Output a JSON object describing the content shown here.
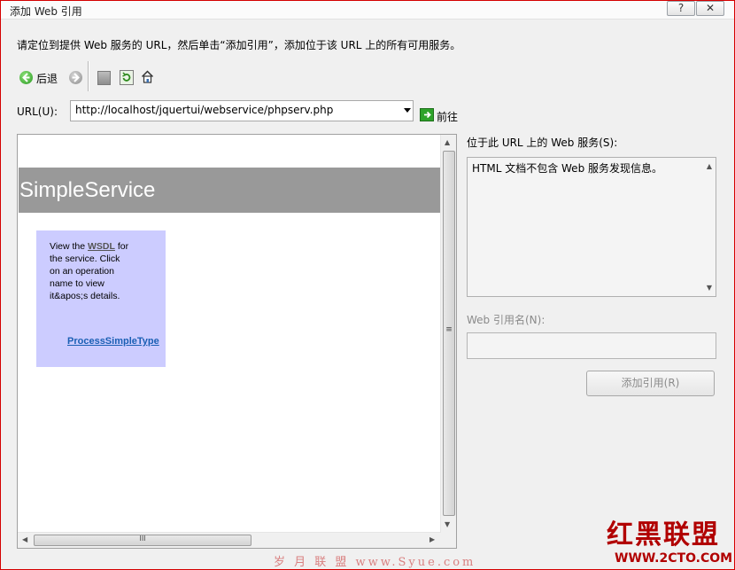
{
  "window": {
    "title": "添加 Web 引用",
    "help_btn": "?",
    "close_btn": "✕"
  },
  "instruction": "请定位到提供 Web 服务的 URL，然后单击“添加引用”，添加位于该 URL 上的所有可用服务。",
  "toolbar": {
    "back_label": "后退",
    "icons": [
      "back-arrow-icon",
      "forward-arrow-icon",
      "stop-icon",
      "refresh-icon",
      "home-icon"
    ]
  },
  "url": {
    "label": "URL(U):",
    "value": "http://localhost/jquertui/webservice/phpserv.php",
    "go_label": "前往"
  },
  "browser": {
    "banner_title": "SimpleService",
    "side_text_1": "View the",
    "side_link_wsdl": "WSDL",
    "side_text_2": "for the service. Click on an operation name to view it&apos;s details.",
    "operation_link": "ProcessSimpleType",
    "hscroll_grip": "III",
    "vscroll_grip": "≡"
  },
  "services": {
    "label": "位于此 URL 上的 Web 服务(S):",
    "message": "HTML 文档不包含 Web 服务发现信息。"
  },
  "reference": {
    "label": "Web 引用名(N):",
    "value": "",
    "add_button": "添加引用(R)"
  },
  "watermark": {
    "logo": "红黑联盟",
    "site": "WWW.2CTO.COM",
    "bottom": "岁 月 联 盟 www.Syue.com"
  },
  "colors": {
    "frame_border": "#d40000",
    "banner": "#999999",
    "sidebox": "#ccccff",
    "link": "#1a5fb4",
    "watermark": "#b10000"
  }
}
